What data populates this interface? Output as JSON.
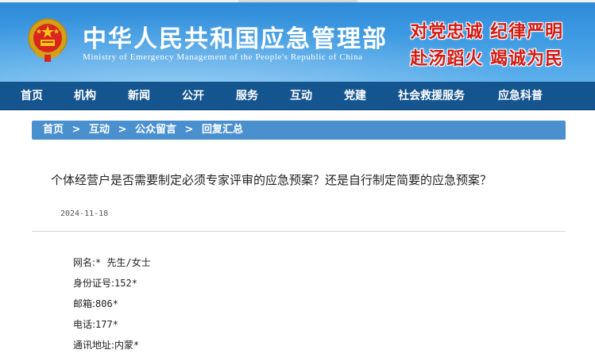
{
  "header": {
    "title": "中华人民共和国应急管理部",
    "subtitle": "Ministry of Emergency Management of the People's Republic of China",
    "slogan_line1": "对党忠诚  纪律严明",
    "slogan_line2": "赴汤蹈火  竭诚为民",
    "emblem_icon": "national-emblem-icon"
  },
  "nav": {
    "items": [
      "首页",
      "机构",
      "新闻",
      "公开",
      "服务",
      "互动",
      "党建",
      "社会救援服务",
      "应急科普"
    ]
  },
  "breadcrumb": {
    "items": [
      "首页",
      "互动",
      "公众留言",
      "回复汇总"
    ],
    "separator": ">"
  },
  "article": {
    "title": "个体经营户是否需要制定必须专家评审的应急预案？还是自行制定简要的应急预案？",
    "date": "2024-11-18",
    "fields": [
      {
        "label": "网名:",
        "value": "* 先生/女士"
      },
      {
        "label": "身份证号:",
        "value": "152*"
      },
      {
        "label": "邮箱:",
        "value": "806*"
      },
      {
        "label": "电话:",
        "value": "177*"
      },
      {
        "label": "通讯地址:",
        "value": "内蒙*"
      }
    ]
  },
  "colors": {
    "header_blue": "#3d9ae2",
    "nav_blue": "#15558f",
    "breadcrumb_blue": "#4a90cf",
    "slogan_red": "#d21a12"
  }
}
